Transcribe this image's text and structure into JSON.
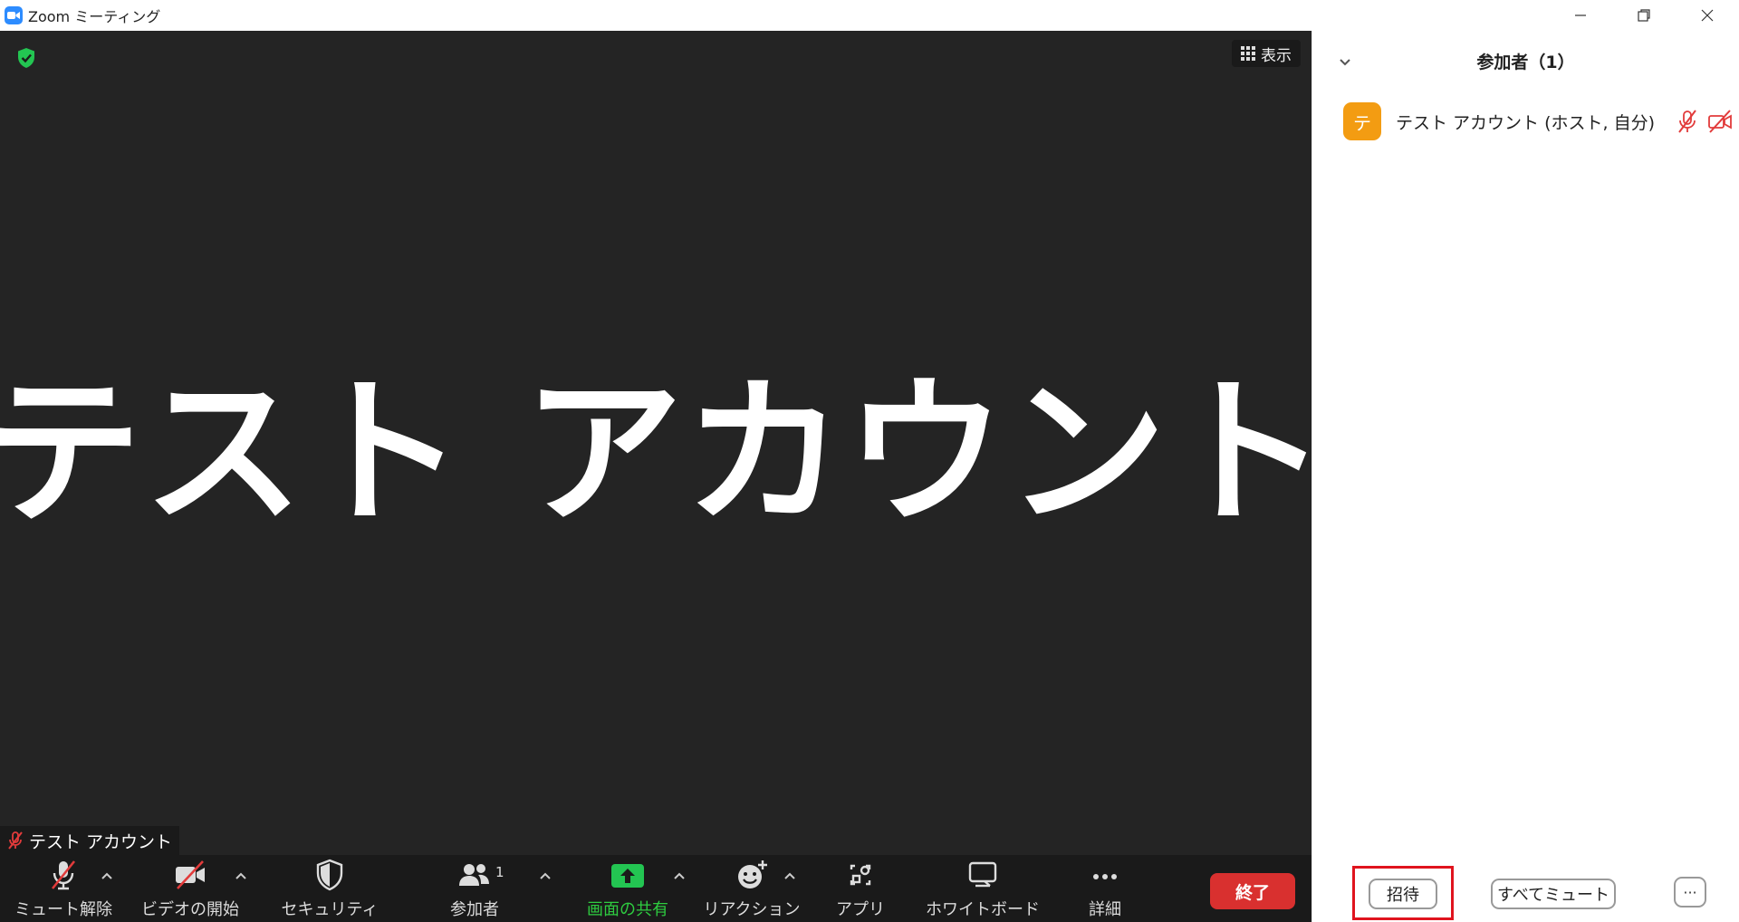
{
  "window": {
    "title": "Zoom ミーティング"
  },
  "video": {
    "view_label": "表示",
    "display_name": "テスト アカウント",
    "name_tag": "テスト アカウント"
  },
  "toolbar": {
    "items": [
      {
        "label": "ミュート解除",
        "icon": "mic-muted-icon"
      },
      {
        "label": "ビデオの開始",
        "icon": "video-off-icon"
      },
      {
        "label": "セキュリティ",
        "icon": "shield-icon"
      },
      {
        "label": "参加者",
        "icon": "participants-icon",
        "count": "1"
      },
      {
        "label": "画面の共有",
        "icon": "share-screen-icon"
      },
      {
        "label": "リアクション",
        "icon": "reaction-icon"
      },
      {
        "label": "アプリ",
        "icon": "apps-icon"
      },
      {
        "label": "ホワイトボード",
        "icon": "whiteboard-icon"
      },
      {
        "label": "詳細",
        "icon": "more-icon"
      }
    ],
    "end_label": "終了"
  },
  "participants": {
    "title": "参加者（1）",
    "list": [
      {
        "initial": "テ",
        "name": "テスト アカウント (ホスト, 自分)",
        "avatar_color": "#f39c12"
      }
    ],
    "invite_label": "招待",
    "mute_all_label": "すべてミュート",
    "more_label": "···"
  },
  "colors": {
    "accent": "#2d8cff",
    "share_green": "#2ecc40",
    "end_red": "#d9302f",
    "highlight_red": "#e0141e",
    "muted_red": "#e23b3b"
  }
}
